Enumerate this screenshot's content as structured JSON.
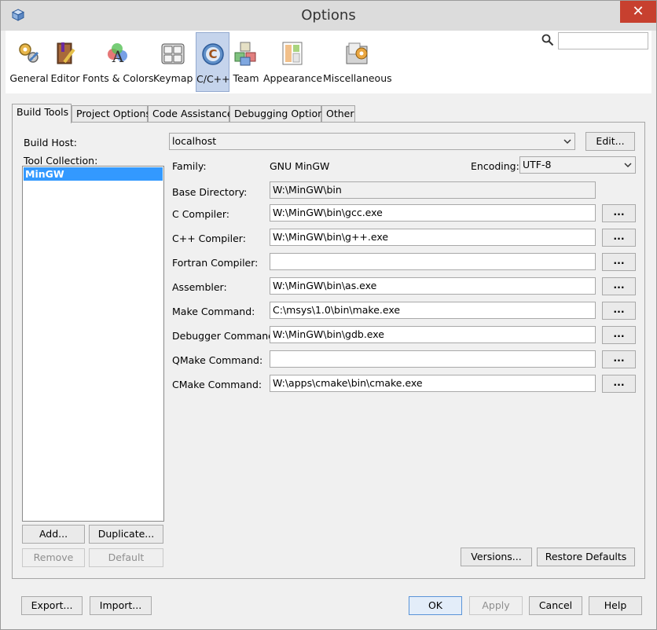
{
  "window": {
    "title": "Options",
    "close_label": "✕"
  },
  "categories": [
    {
      "label": "General",
      "icon": "gears-icon"
    },
    {
      "label": "Editor",
      "icon": "editor-book-icon"
    },
    {
      "label": "Fonts & Colors",
      "icon": "fonts-colors-icon"
    },
    {
      "label": "Keymap",
      "icon": "keyboard-icon"
    },
    {
      "label": "C/C++",
      "icon": "cpp-icon",
      "selected": true
    },
    {
      "label": "Team",
      "icon": "team-blocks-icon"
    },
    {
      "label": "Appearance",
      "icon": "appearance-icon"
    },
    {
      "label": "Miscellaneous",
      "icon": "miscellaneous-icon"
    }
  ],
  "search": {
    "value": ""
  },
  "tabs": [
    {
      "label": "Build Tools",
      "active": true
    },
    {
      "label": "Project Options"
    },
    {
      "label": "Code Assistance"
    },
    {
      "label": "Debugging Options"
    },
    {
      "label": "Other"
    }
  ],
  "build_tools": {
    "build_host_label": "Build Host:",
    "build_host_value": "localhost",
    "edit_button": "Edit...",
    "tool_collection_label": "Tool Collection:",
    "tool_collections": [
      "MinGW"
    ],
    "add_button": "Add...",
    "duplicate_button": "Duplicate...",
    "remove_button": "Remove",
    "default_button": "Default",
    "family_label": "Family:",
    "family_value": "GNU MinGW",
    "encoding_label": "Encoding:",
    "encoding_value": "UTF-8",
    "base_directory_label": "Base Directory:",
    "base_directory_value": "W:\\MinGW\\bin",
    "browse_label": "...",
    "tools": [
      {
        "label": "C Compiler:",
        "value": "W:\\MinGW\\bin\\gcc.exe"
      },
      {
        "label": "C++ Compiler:",
        "value": "W:\\MinGW\\bin\\g++.exe"
      },
      {
        "label": "Fortran Compiler:",
        "value": ""
      },
      {
        "label": "Assembler:",
        "value": "W:\\MinGW\\bin\\as.exe"
      },
      {
        "label": "Make Command:",
        "value": "C:\\msys\\1.0\\bin\\make.exe"
      },
      {
        "label": "Debugger Command:",
        "value": "W:\\MinGW\\bin\\gdb.exe"
      },
      {
        "label": "QMake Command:",
        "value": ""
      },
      {
        "label": "CMake Command:",
        "value": "W:\\apps\\cmake\\bin\\cmake.exe"
      }
    ],
    "versions_button": "Versions...",
    "restore_defaults_button": "Restore Defaults"
  },
  "footer": {
    "export_button": "Export...",
    "import_button": "Import...",
    "ok_button": "OK",
    "apply_button": "Apply",
    "cancel_button": "Cancel",
    "help_button": "Help"
  }
}
